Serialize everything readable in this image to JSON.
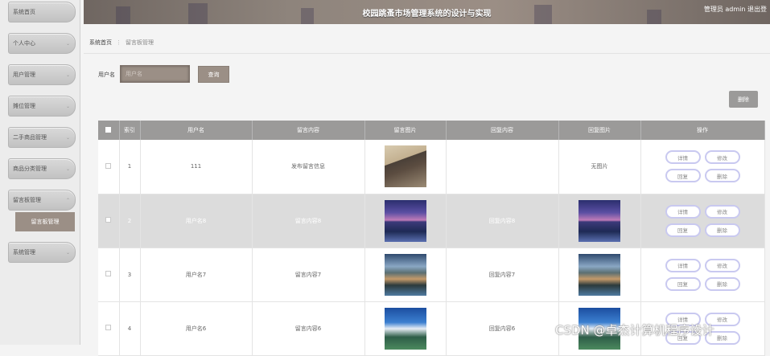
{
  "sidebar": {
    "items": [
      {
        "label": "系统首页",
        "chevron": ""
      },
      {
        "label": "个人中心",
        "chevron": "⌄"
      },
      {
        "label": "用户管理",
        "chevron": "⌄"
      },
      {
        "label": "摊位管理",
        "chevron": "⌄"
      },
      {
        "label": "二手商品管理",
        "chevron": "⌄"
      },
      {
        "label": "商品分类管理",
        "chevron": "⌄"
      },
      {
        "label": "留言板管理",
        "chevron": "⌃"
      },
      {
        "label": "系统管理",
        "chevron": "⌄"
      }
    ],
    "subitem": "留言板管理"
  },
  "header": {
    "title": "校园跳蚤市场管理系统的设计与实现",
    "user": "管理员 admin  退出登"
  },
  "breadcrumb": {
    "home": "系统首页",
    "sep": "⋮",
    "current": "留言板管理"
  },
  "search": {
    "label": "用户名",
    "placeholder": "用户名",
    "query_btn": "查询"
  },
  "toolbar": {
    "delete_btn": "删除"
  },
  "table": {
    "headers": [
      "",
      "索引",
      "用户名",
      "留言内容",
      "留言图片",
      "回复内容",
      "回复图片",
      "操作"
    ],
    "rows": [
      {
        "index": "1",
        "username": "111",
        "content": "发布留言信息",
        "reply": "",
        "reply_img": "无图片"
      },
      {
        "index": "2",
        "username": "用户名8",
        "content": "留言内容8",
        "reply": "回复内容8",
        "reply_img": ""
      },
      {
        "index": "3",
        "username": "用户名7",
        "content": "留言内容7",
        "reply": "回复内容7",
        "reply_img": ""
      },
      {
        "index": "4",
        "username": "用户名6",
        "content": "留言内容6",
        "reply": "回复内容6",
        "reply_img": ""
      }
    ],
    "ops": {
      "detail": "详情",
      "edit": "修改",
      "reply": "回复",
      "delete": "删除"
    }
  },
  "watermark": "CSDN @卓杰计算机程序设计"
}
